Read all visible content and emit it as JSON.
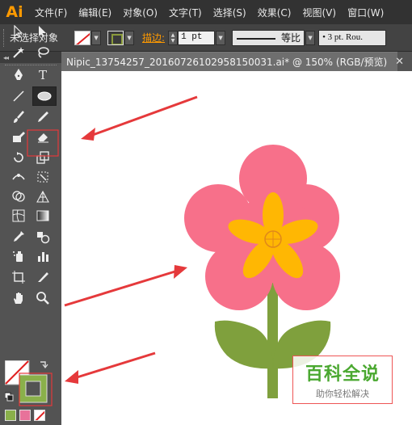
{
  "app": {
    "logo_text": "Ai",
    "logo_color": "#ff9a00"
  },
  "menu": [
    "文件(F)",
    "编辑(E)",
    "对象(O)",
    "文字(T)",
    "选择(S)",
    "效果(C)",
    "视图(V)",
    "窗口(W)"
  ],
  "control_bar": {
    "selection_status": "未选择对象",
    "stroke_label": "描边:",
    "stroke_weight": "1 pt",
    "line_profile": "等比",
    "brush": "• 3 pt. Rou."
  },
  "toolbar": {
    "collapse_glyph": "◂◂"
  },
  "document_tab": {
    "title": "Nipic_13754257_20160726102958150031.ai* @ 150% (RGB/预览)",
    "close_glyph": "✕"
  },
  "artwork": {
    "petal_color": "#f7708a",
    "inner_petal_color": "#ffb703",
    "stem_color": "#7fa03d",
    "center_stroke": "#e0881a"
  },
  "annotations": {
    "arrow_color": "#e5393b",
    "highlight_color": "#e5393b"
  },
  "watermark": {
    "brand": "百科全说",
    "tagline": "助你轻松解决",
    "brand_color": "#4aa830"
  },
  "colors": {
    "fill_swatch": "#8ab04a",
    "pink_swatch": "#e8729a"
  }
}
